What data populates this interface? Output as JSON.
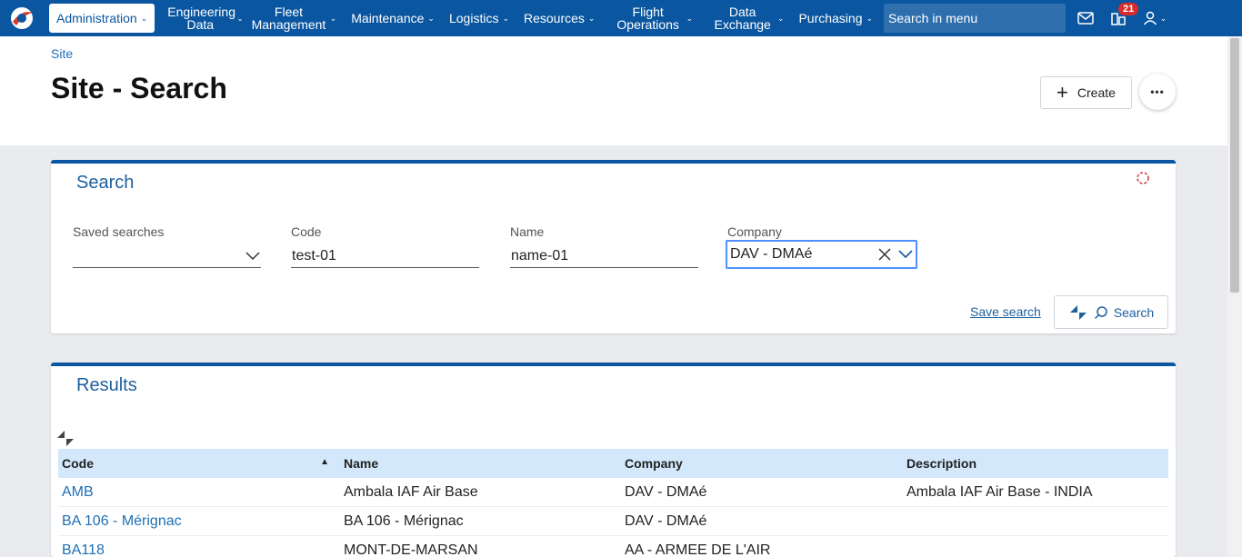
{
  "nav": {
    "items": [
      {
        "label": "Administration",
        "active": true
      },
      {
        "label": "Engineering Data"
      },
      {
        "label": "Fleet Management"
      },
      {
        "label": "Maintenance"
      },
      {
        "label": "Logistics"
      },
      {
        "label": "Resources"
      },
      {
        "label": "Flight Operations"
      },
      {
        "label": "Data Exchange"
      },
      {
        "label": "Purchasing"
      }
    ],
    "search_placeholder": "Search in menu",
    "badge_count": "21"
  },
  "header": {
    "breadcrumb": "Site",
    "title": "Site - Search",
    "create_label": "Create",
    "more_label": "•••"
  },
  "search": {
    "title": "Search",
    "saved_searches_label": "Saved searches",
    "saved_searches_value": "",
    "code_label": "Code",
    "code_value": "test-01",
    "name_label": "Name",
    "name_value": "name-01",
    "company_label": "Company",
    "company_value": "DAV - DMAé",
    "save_search_label": "Save search",
    "search_button_label": "Search"
  },
  "results": {
    "title": "Results",
    "columns": [
      "Code",
      "Name",
      "Company",
      "Description"
    ],
    "rows": [
      {
        "code": "AMB",
        "name": "Ambala IAF Air Base",
        "company": "DAV - DMAé",
        "description": "Ambala IAF Air Base - INDIA"
      },
      {
        "code": "BA 106 - Mérignac",
        "name": "BA 106 - Mérignac",
        "company": "DAV - DMAé",
        "description": ""
      },
      {
        "code": "BA118",
        "name": "MONT-DE-MARSAN",
        "company": "AA - ARMEE DE L'AIR",
        "description": ""
      }
    ]
  },
  "colors": {
    "nav_bg": "#0a56a0",
    "accent": "#1e6fb5",
    "table_header_bg": "#d3e9fb"
  }
}
